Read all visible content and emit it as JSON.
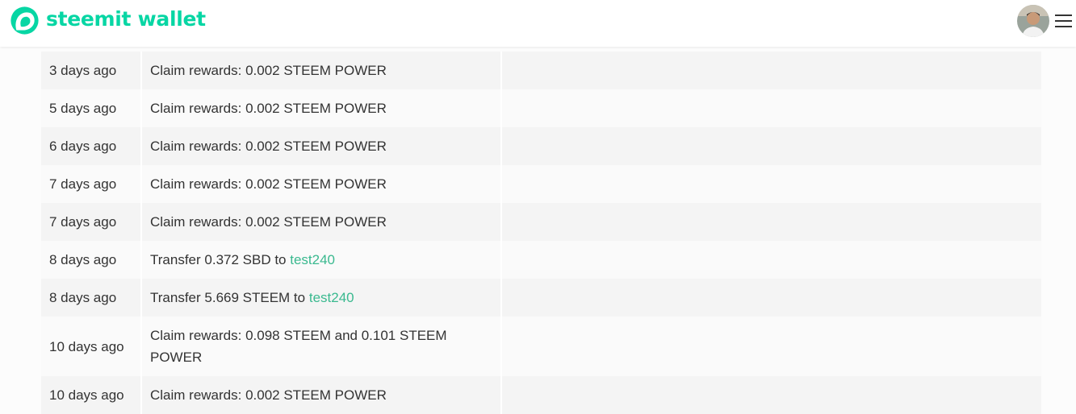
{
  "header": {
    "brand": "steemit wallet",
    "colors": {
      "brand": "#07d6a4",
      "link": "#3ab98f"
    },
    "icons": {
      "logo": "steemit-logo-icon",
      "menu": "hamburger-menu-icon",
      "avatar": "user-avatar"
    }
  },
  "transactions": [
    {
      "date": "3 days ago",
      "text": "Claim rewards: 0.002 STEEM POWER",
      "memo": ""
    },
    {
      "date": "5 days ago",
      "text": "Claim rewards: 0.002 STEEM POWER",
      "memo": ""
    },
    {
      "date": "6 days ago",
      "text": "Claim rewards: 0.002 STEEM POWER",
      "memo": ""
    },
    {
      "date": "7 days ago",
      "text": "Claim rewards: 0.002 STEEM POWER",
      "memo": ""
    },
    {
      "date": "7 days ago",
      "text": "Claim rewards: 0.002 STEEM POWER",
      "memo": ""
    },
    {
      "date": "8 days ago",
      "text": "Transfer 0.372 SBD to ",
      "link": "test240",
      "memo": ""
    },
    {
      "date": "8 days ago",
      "text": "Transfer 5.669 STEEM to ",
      "link": "test240",
      "memo": ""
    },
    {
      "date": "10 days ago",
      "text": "Claim rewards: 0.098 STEEM and 0.101 STEEM POWER",
      "memo": ""
    },
    {
      "date": "10 days ago",
      "text": "Claim rewards: 0.002 STEEM POWER",
      "memo": ""
    }
  ]
}
